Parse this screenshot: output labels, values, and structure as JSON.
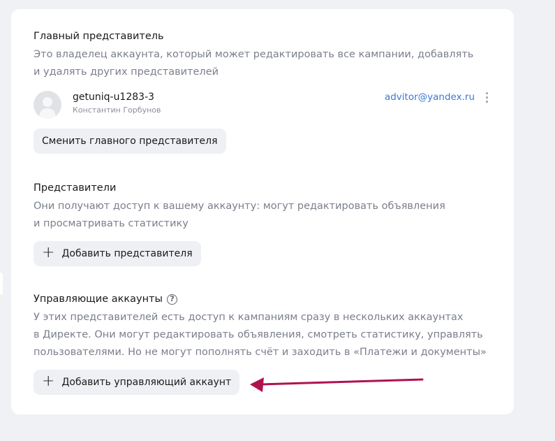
{
  "main_rep": {
    "title": "Главный представитель",
    "desc_line1": "Это владелец аккаунта, который может редактировать все кампании, добавлять",
    "desc_line2": "и удалять других представителей",
    "login": "getuniq-u1283-3",
    "name": "Константин Горбунов",
    "email": "advitor@yandex.ru",
    "change_button": "Сменить главного представителя"
  },
  "reps": {
    "title": "Представители",
    "desc_line1": "Они получают доступ к вашему аккаунту: могут редактировать объявления",
    "desc_line2": "и просматривать статистику",
    "add_button": "Добавить представителя"
  },
  "managing": {
    "title": "Управляющие аккаунты",
    "help_icon": "question-circle-icon",
    "desc_line1": "У этих представителей есть доступ к кампаниям сразу в нескольких аккаунтах",
    "desc_line2": "в Директе. Они могут редактировать объявления, смотреть статистику, управлять",
    "desc_line3": "пользователями. Но не могут пополнять счёт и заходить в «Платежи и документы»",
    "add_button": "Добавить управляющий аккаунт"
  },
  "colors": {
    "accent_link": "#3a78d6",
    "annotation_arrow": "#b0124f",
    "button_bg": "#eef0f4"
  }
}
